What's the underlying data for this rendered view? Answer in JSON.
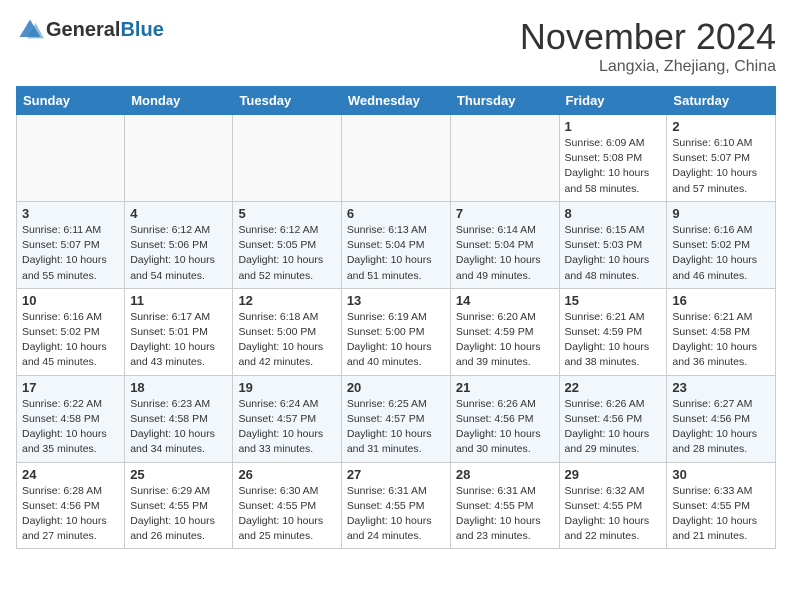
{
  "header": {
    "logo_general": "General",
    "logo_blue": "Blue",
    "month": "November 2024",
    "location": "Langxia, Zhejiang, China"
  },
  "weekdays": [
    "Sunday",
    "Monday",
    "Tuesday",
    "Wednesday",
    "Thursday",
    "Friday",
    "Saturday"
  ],
  "weeks": [
    [
      {
        "day": "",
        "info": ""
      },
      {
        "day": "",
        "info": ""
      },
      {
        "day": "",
        "info": ""
      },
      {
        "day": "",
        "info": ""
      },
      {
        "day": "",
        "info": ""
      },
      {
        "day": "1",
        "info": "Sunrise: 6:09 AM\nSunset: 5:08 PM\nDaylight: 10 hours\nand 58 minutes."
      },
      {
        "day": "2",
        "info": "Sunrise: 6:10 AM\nSunset: 5:07 PM\nDaylight: 10 hours\nand 57 minutes."
      }
    ],
    [
      {
        "day": "3",
        "info": "Sunrise: 6:11 AM\nSunset: 5:07 PM\nDaylight: 10 hours\nand 55 minutes."
      },
      {
        "day": "4",
        "info": "Sunrise: 6:12 AM\nSunset: 5:06 PM\nDaylight: 10 hours\nand 54 minutes."
      },
      {
        "day": "5",
        "info": "Sunrise: 6:12 AM\nSunset: 5:05 PM\nDaylight: 10 hours\nand 52 minutes."
      },
      {
        "day": "6",
        "info": "Sunrise: 6:13 AM\nSunset: 5:04 PM\nDaylight: 10 hours\nand 51 minutes."
      },
      {
        "day": "7",
        "info": "Sunrise: 6:14 AM\nSunset: 5:04 PM\nDaylight: 10 hours\nand 49 minutes."
      },
      {
        "day": "8",
        "info": "Sunrise: 6:15 AM\nSunset: 5:03 PM\nDaylight: 10 hours\nand 48 minutes."
      },
      {
        "day": "9",
        "info": "Sunrise: 6:16 AM\nSunset: 5:02 PM\nDaylight: 10 hours\nand 46 minutes."
      }
    ],
    [
      {
        "day": "10",
        "info": "Sunrise: 6:16 AM\nSunset: 5:02 PM\nDaylight: 10 hours\nand 45 minutes."
      },
      {
        "day": "11",
        "info": "Sunrise: 6:17 AM\nSunset: 5:01 PM\nDaylight: 10 hours\nand 43 minutes."
      },
      {
        "day": "12",
        "info": "Sunrise: 6:18 AM\nSunset: 5:00 PM\nDaylight: 10 hours\nand 42 minutes."
      },
      {
        "day": "13",
        "info": "Sunrise: 6:19 AM\nSunset: 5:00 PM\nDaylight: 10 hours\nand 40 minutes."
      },
      {
        "day": "14",
        "info": "Sunrise: 6:20 AM\nSunset: 4:59 PM\nDaylight: 10 hours\nand 39 minutes."
      },
      {
        "day": "15",
        "info": "Sunrise: 6:21 AM\nSunset: 4:59 PM\nDaylight: 10 hours\nand 38 minutes."
      },
      {
        "day": "16",
        "info": "Sunrise: 6:21 AM\nSunset: 4:58 PM\nDaylight: 10 hours\nand 36 minutes."
      }
    ],
    [
      {
        "day": "17",
        "info": "Sunrise: 6:22 AM\nSunset: 4:58 PM\nDaylight: 10 hours\nand 35 minutes."
      },
      {
        "day": "18",
        "info": "Sunrise: 6:23 AM\nSunset: 4:58 PM\nDaylight: 10 hours\nand 34 minutes."
      },
      {
        "day": "19",
        "info": "Sunrise: 6:24 AM\nSunset: 4:57 PM\nDaylight: 10 hours\nand 33 minutes."
      },
      {
        "day": "20",
        "info": "Sunrise: 6:25 AM\nSunset: 4:57 PM\nDaylight: 10 hours\nand 31 minutes."
      },
      {
        "day": "21",
        "info": "Sunrise: 6:26 AM\nSunset: 4:56 PM\nDaylight: 10 hours\nand 30 minutes."
      },
      {
        "day": "22",
        "info": "Sunrise: 6:26 AM\nSunset: 4:56 PM\nDaylight: 10 hours\nand 29 minutes."
      },
      {
        "day": "23",
        "info": "Sunrise: 6:27 AM\nSunset: 4:56 PM\nDaylight: 10 hours\nand 28 minutes."
      }
    ],
    [
      {
        "day": "24",
        "info": "Sunrise: 6:28 AM\nSunset: 4:56 PM\nDaylight: 10 hours\nand 27 minutes."
      },
      {
        "day": "25",
        "info": "Sunrise: 6:29 AM\nSunset: 4:55 PM\nDaylight: 10 hours\nand 26 minutes."
      },
      {
        "day": "26",
        "info": "Sunrise: 6:30 AM\nSunset: 4:55 PM\nDaylight: 10 hours\nand 25 minutes."
      },
      {
        "day": "27",
        "info": "Sunrise: 6:31 AM\nSunset: 4:55 PM\nDaylight: 10 hours\nand 24 minutes."
      },
      {
        "day": "28",
        "info": "Sunrise: 6:31 AM\nSunset: 4:55 PM\nDaylight: 10 hours\nand 23 minutes."
      },
      {
        "day": "29",
        "info": "Sunrise: 6:32 AM\nSunset: 4:55 PM\nDaylight: 10 hours\nand 22 minutes."
      },
      {
        "day": "30",
        "info": "Sunrise: 6:33 AM\nSunset: 4:55 PM\nDaylight: 10 hours\nand 21 minutes."
      }
    ]
  ]
}
